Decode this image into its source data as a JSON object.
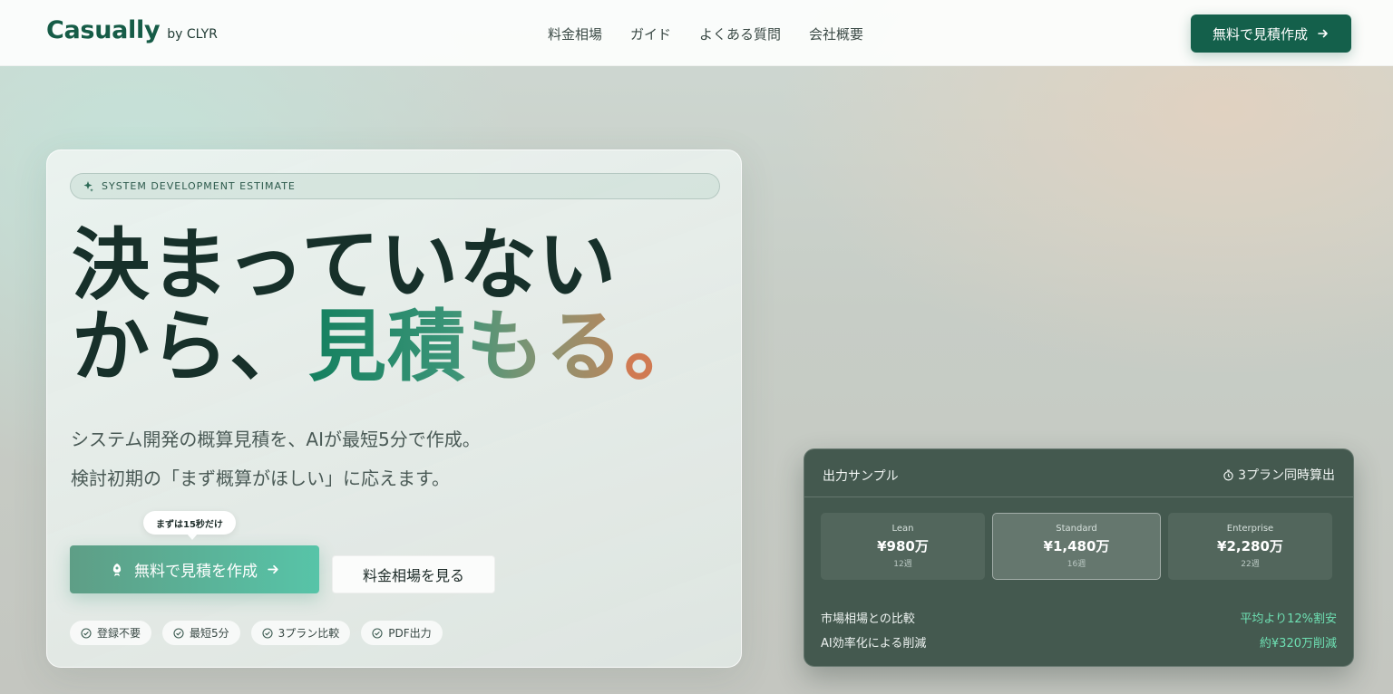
{
  "header": {
    "logo": "Casually",
    "logo_sub": "by CLYR",
    "nav": [
      "料金相場",
      "ガイド",
      "よくある質問",
      "会社概要"
    ],
    "cta": "無料で見積作成"
  },
  "hero": {
    "tag": "SYSTEM DEVELOPMENT ESTIMATE",
    "headline_line1": "決まっていない",
    "headline_line2_a": "から、",
    "headline_line2_b": "見積もる",
    "headline_line2_c": "。",
    "sub_line1": "システム開発の概算見積を、AIが最短5分で作成。",
    "sub_line2": "検討初期の「まず概算がほしい」に応えます。",
    "bubble": "まずは15秒だけ",
    "primary_button": "無料で見積を作成",
    "secondary_button": "料金相場を見る",
    "features": [
      "登録不要",
      "最短5分",
      "3プラン比較",
      "PDF出力"
    ]
  },
  "sample": {
    "title": "出力サンプル",
    "note": "3プラン同時算出",
    "plans": [
      {
        "name": "Lean",
        "price": "¥980万",
        "weeks": "12週"
      },
      {
        "name": "Standard",
        "price": "¥1,480万",
        "weeks": "16週"
      },
      {
        "name": "Enterprise",
        "price": "¥2,280万",
        "weeks": "22週"
      }
    ],
    "selected_plan": "Standard",
    "rows": [
      {
        "label": "市場相場との比較",
        "value": "平均より12%割安"
      },
      {
        "label": "AI効率化による削減",
        "value": "約¥320万削減"
      }
    ]
  },
  "colors": {
    "brand": "#14604b",
    "accent_green": "#57c4a8",
    "highlight": "#6ee0b3",
    "dot": "#d07a52"
  },
  "icons": [
    "arrow-right-icon",
    "sparkle-icon",
    "rocket-icon",
    "check-circle-icon",
    "timer-icon"
  ]
}
